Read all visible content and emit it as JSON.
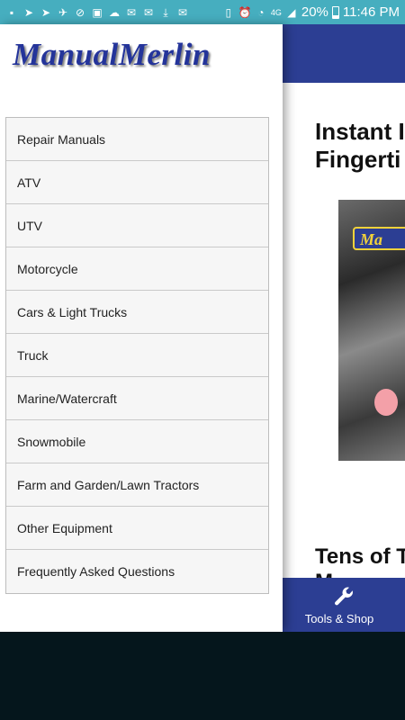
{
  "status_bar": {
    "battery_percent": "20%",
    "time": "11:46 PM",
    "network": "4G",
    "left_icons": [
      "chat-icon",
      "send-icon",
      "send-icon",
      "drone-icon",
      "block-icon",
      "image-icon",
      "cloud-icon",
      "mail-icon",
      "mail-icon",
      "download-icon",
      "mail-icon"
    ]
  },
  "drawer": {
    "logo": "ManualMerlin",
    "items": [
      "Repair Manuals",
      "ATV",
      "UTV",
      "Motorcycle",
      "Cars & Light Trucks",
      "Truck",
      "Marine/Watercraft",
      "Snowmobile",
      "Farm and Garden/Lawn Tractors",
      "Other Equipment",
      "Frequently Asked Questions"
    ]
  },
  "page": {
    "heading": "Instant I\nFingerti",
    "hero_banner_text": "Ma",
    "subheading": "Tens of T\nM"
  },
  "bottom_tab": {
    "label": "Tools & Shop",
    "icon": "wrench-icon"
  },
  "colors": {
    "status_bar": "#46aebf",
    "brand_blue": "#2c3e93",
    "menu_bg": "#f6f6f6"
  }
}
